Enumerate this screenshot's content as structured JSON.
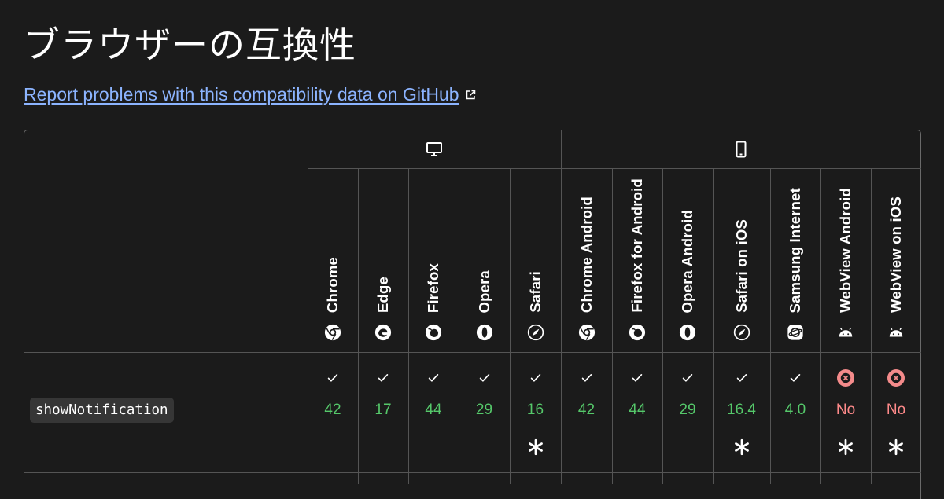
{
  "heading": "ブラウザーの互換性",
  "report_link": {
    "label": "Report problems with this compatibility data on GitHub",
    "icon": "external-link-icon"
  },
  "platforms": {
    "desktop": {
      "icon": "desktop-icon"
    },
    "mobile": {
      "icon": "mobile-icon"
    }
  },
  "browsers": [
    {
      "name": "Chrome",
      "icon": "chrome-icon"
    },
    {
      "name": "Edge",
      "icon": "edge-icon"
    },
    {
      "name": "Firefox",
      "icon": "firefox-icon"
    },
    {
      "name": "Opera",
      "icon": "opera-icon"
    },
    {
      "name": "Safari",
      "icon": "safari-icon"
    },
    {
      "name": "Chrome Android",
      "icon": "chrome-icon"
    },
    {
      "name": "Firefox for Android",
      "icon": "firefox-icon"
    },
    {
      "name": "Opera Android",
      "icon": "opera-icon"
    },
    {
      "name": "Safari on iOS",
      "icon": "safari-icon"
    },
    {
      "name": "Samsung Internet",
      "icon": "samsung-internet-icon"
    },
    {
      "name": "WebView Android",
      "icon": "android-icon"
    },
    {
      "name": "WebView on iOS",
      "icon": "android-icon"
    }
  ],
  "feature": {
    "name": "showNotification",
    "support": [
      {
        "supported": true,
        "version": "42",
        "note": false
      },
      {
        "supported": true,
        "version": "17",
        "note": false
      },
      {
        "supported": true,
        "version": "44",
        "note": false
      },
      {
        "supported": true,
        "version": "29",
        "note": false
      },
      {
        "supported": true,
        "version": "16",
        "note": true
      },
      {
        "supported": true,
        "version": "42",
        "note": false
      },
      {
        "supported": true,
        "version": "44",
        "note": false
      },
      {
        "supported": true,
        "version": "29",
        "note": false
      },
      {
        "supported": true,
        "version": "16.4",
        "note": true
      },
      {
        "supported": true,
        "version": "4.0",
        "note": false
      },
      {
        "supported": false,
        "version": "No",
        "note": true
      },
      {
        "supported": false,
        "version": "No",
        "note": true
      }
    ]
  },
  "colors": {
    "supported": "#55c86a",
    "unsupported": "#ff8a8a",
    "unsupported_icon_bg": "#f48b8b",
    "link": "#8cb4ff",
    "border": "#555555"
  }
}
